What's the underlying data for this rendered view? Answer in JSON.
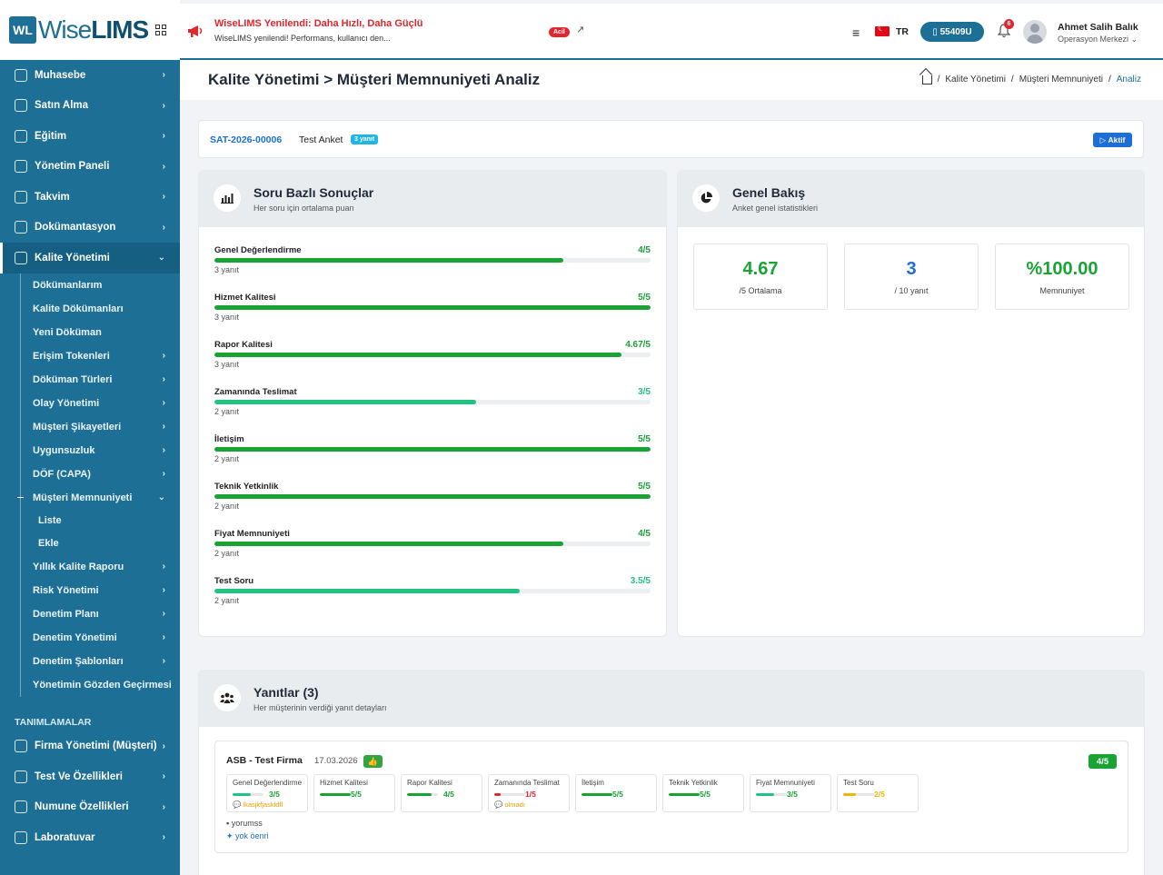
{
  "logo": {
    "mark": "WL",
    "text_light": "Wise",
    "text_bold": "LIMS"
  },
  "sidebar": {
    "items_top": [
      {
        "label": "Muhasebe"
      },
      {
        "label": "Satın Alma"
      },
      {
        "label": "Eğitim"
      },
      {
        "label": "Yönetim Paneli"
      },
      {
        "label": "Takvim"
      },
      {
        "label": "Dokümantasyon"
      },
      {
        "label": "Kalite Yönetimi"
      }
    ],
    "kalite_sub": [
      {
        "label": "Dökümanlarım"
      },
      {
        "label": "Kalite Dökümanları"
      },
      {
        "label": "Yeni Döküman"
      },
      {
        "label": "Erişim Tokenleri"
      },
      {
        "label": "Döküman Türleri"
      },
      {
        "label": "Olay Yönetimi"
      },
      {
        "label": "Müşteri Şikayetleri"
      },
      {
        "label": "Uygunsuzluk"
      },
      {
        "label": "DÖF (CAPA)"
      },
      {
        "label": "Müşteri Memnuniyeti"
      }
    ],
    "memnuniyet_sub": [
      {
        "label": "Liste"
      },
      {
        "label": "Ekle"
      }
    ],
    "kalite_sub2": [
      {
        "label": "Yıllık Kalite Raporu"
      },
      {
        "label": "Risk Yönetimi"
      },
      {
        "label": "Denetim Planı"
      },
      {
        "label": "Denetim Yönetimi"
      },
      {
        "label": "Denetim Şablonları"
      },
      {
        "label": "Yönetimin Gözden Geçirmesi"
      }
    ],
    "section_title": "TANIMLAMALAR",
    "items_bottom": [
      {
        "label": "Firma Yönetimi (Müşteri)"
      },
      {
        "label": "Test Ve Özellikleri"
      },
      {
        "label": "Numune Özellikleri"
      },
      {
        "label": "Laboratuvar"
      }
    ]
  },
  "topbar": {
    "announce_title": "WiseLIMS Yenilendi: Daha Hızlı, Daha Güçlü",
    "announce_sub": "WiseLIMS yenilendi! Performans, kullanıcı den...",
    "announce_badge": "Acil",
    "lang": "TR",
    "code": "55409U",
    "notif_count": "6",
    "user_name": "Ahmet Salih Balık",
    "user_role": "Operasyon Merkezi"
  },
  "page": {
    "title": "Kalite Yönetimi > Müşteri Memnuniyeti Analiz",
    "breadcrumb": [
      "Kalite Yönetimi",
      "Müşteri Memnuniyeti",
      "Analiz"
    ]
  },
  "survey": {
    "code": "SAT-2026-00006",
    "name": "Test Anket",
    "badge": "3 yanıt",
    "status": "Aktif"
  },
  "questions_card": {
    "title": "Soru Bazlı Sonuçlar",
    "subtitle": "Her soru için ortalama puan"
  },
  "questions": [
    {
      "label": "Genel Değerlendirme",
      "score": "4/5",
      "value": 4,
      "count": "3 yanıt",
      "color": "#1aa335"
    },
    {
      "label": "Hizmet Kalitesi",
      "score": "5/5",
      "value": 5,
      "count": "3 yanıt",
      "color": "#1aa335"
    },
    {
      "label": "Rapor Kalitesi",
      "score": "4.67/5",
      "value": 4.67,
      "count": "3 yanıt",
      "color": "#1aa335"
    },
    {
      "label": "Zamanında Teslimat",
      "score": "3/5",
      "value": 3,
      "count": "2 yanıt",
      "color": "#20c383"
    },
    {
      "label": "İletişim",
      "score": "5/5",
      "value": 5,
      "count": "2 yanıt",
      "color": "#1aa335"
    },
    {
      "label": "Teknik Yetkinlik",
      "score": "5/5",
      "value": 5,
      "count": "2 yanıt",
      "color": "#1aa335"
    },
    {
      "label": "Fiyat Memnuniyeti",
      "score": "4/5",
      "value": 4,
      "count": "2 yanıt",
      "color": "#1aa335"
    },
    {
      "label": "Test Soru",
      "score": "3.5/5",
      "value": 3.5,
      "count": "2 yanıt",
      "color": "#20c383"
    }
  ],
  "overview_card": {
    "title": "Genel Bakış",
    "subtitle": "Anket genel istatistikleri"
  },
  "stats": [
    {
      "value": "4.67",
      "label": "/5 Ortalama",
      "color": "#1aa335"
    },
    {
      "value": "3",
      "label": "/ 10 yanıt",
      "color": "#1d6fd6"
    },
    {
      "value": "%100.00",
      "label": "Memnuniyet",
      "color": "#1aa335"
    }
  ],
  "responses_card": {
    "title": "Yanıtlar (3)",
    "subtitle": "Her müşterinin verdiği yanıt detayları"
  },
  "response": {
    "firm": "ASB - Test Firma",
    "date": "17.03.2026",
    "thumb": "👍",
    "score": "4/5",
    "answers": [
      {
        "label": "Genel Değerlendirme",
        "score": "3/5",
        "value": 3,
        "color": "#20c383",
        "note": "💬 lkasjkfjaskldfl"
      },
      {
        "label": "Hizmet Kalitesi",
        "score": "5/5",
        "value": 5,
        "color": "#1aa335",
        "note": ""
      },
      {
        "label": "Rapor Kalitesi",
        "score": "4/5",
        "value": 4,
        "color": "#1aa335",
        "note": ""
      },
      {
        "label": "Zamanında Teslimat",
        "score": "1/5",
        "value": 1,
        "color": "#e0262f",
        "note": "💬 olmadı"
      },
      {
        "label": "İletişim",
        "score": "5/5",
        "value": 5,
        "color": "#1aa335",
        "note": ""
      },
      {
        "label": "Teknik Yetkinlik",
        "score": "5/5",
        "value": 5,
        "color": "#1aa335",
        "note": ""
      },
      {
        "label": "Fiyat Memnuniyeti",
        "score": "3/5",
        "value": 3,
        "color": "#20c383",
        "note": ""
      },
      {
        "label": "Test Soru",
        "score": "2/5",
        "value": 2,
        "color": "#f2b600",
        "note": ""
      }
    ],
    "comment": "yorumss",
    "suggestion": "yok öenri"
  }
}
